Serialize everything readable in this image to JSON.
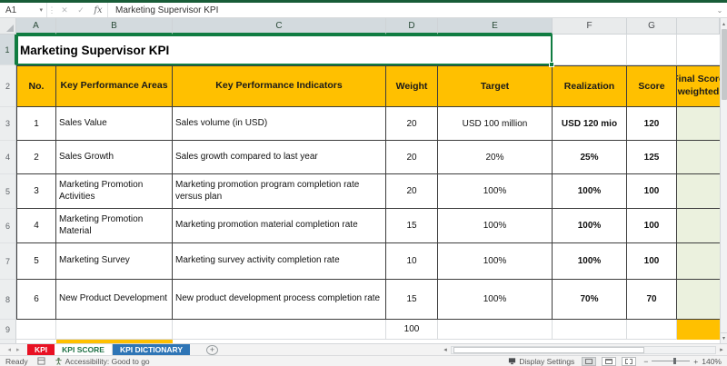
{
  "chrome": {
    "formula_bar": {
      "name_box": "A1",
      "formula": "Marketing Supervisor KPI",
      "fx_label": "fx"
    },
    "column_headers": [
      "A",
      "B",
      "C",
      "D",
      "E",
      "F",
      "G",
      ""
    ],
    "row_headers": [
      "1",
      "2",
      "3",
      "4",
      "5",
      "6",
      "7",
      "8",
      "9"
    ],
    "selected_cell": "A1"
  },
  "icons": {
    "dropdown": "▾",
    "dots": "⋮",
    "cancel": "✕",
    "enter": "✓",
    "expand": "⌄",
    "tab_left": "◂",
    "tab_right": "▸",
    "add_sheet": "+",
    "scroll_up": "▴",
    "scroll_down": "▾",
    "scroll_left": "◂",
    "scroll_right": "▸",
    "zoom_out": "−",
    "zoom_in": "+"
  },
  "sheet": {
    "title": "Marketing Supervisor KPI",
    "table": {
      "headers": {
        "no": "No.",
        "areas": "Key Performance Areas",
        "indicators": "Key Performance Indicators",
        "weight": "Weight",
        "target": "Target",
        "realization": "Realization",
        "score": "Score",
        "final": "Final Score weighted"
      },
      "rows": [
        {
          "no": "1",
          "area": "Sales Value",
          "indicator": "Sales volume (in USD)",
          "weight": "20",
          "target": "USD 100 million",
          "realization": "USD 120 mio",
          "score": "120"
        },
        {
          "no": "2",
          "area": "Sales Growth",
          "indicator": "Sales growth compared to last year",
          "weight": "20",
          "target": "20%",
          "realization": "25%",
          "score": "125"
        },
        {
          "no": "3",
          "area": "Marketing Promotion Activities",
          "indicator": "Marketing promotion program completion rate versus plan",
          "weight": "20",
          "target": "100%",
          "realization": "100%",
          "score": "100"
        },
        {
          "no": "4",
          "area": "Marketing Promotion Material",
          "indicator": "Marketing promotion material completion rate",
          "weight": "15",
          "target": "100%",
          "realization": "100%",
          "score": "100"
        },
        {
          "no": "5",
          "area": "Marketing Survey",
          "indicator": "Marketing survey activity completion rate",
          "weight": "10",
          "target": "100%",
          "realization": "100%",
          "score": "100"
        },
        {
          "no": "6",
          "area": "New Product Development",
          "indicator": "New product development process completion rate",
          "weight": "15",
          "target": "100%",
          "realization": "70%",
          "score": "70"
        }
      ],
      "total_weight": "100"
    }
  },
  "sheet_tabs": {
    "items": [
      {
        "label": "KPI",
        "color": "#E81123"
      },
      {
        "label": "KPI SCORE",
        "active": true
      },
      {
        "label": "KPI DICTIONARY",
        "color": "#2E75B6"
      }
    ]
  },
  "status_bar": {
    "ready": "Ready",
    "accessibility": "Accessibility: Good to go",
    "display_settings": "Display Settings",
    "zoom_level": "140%"
  },
  "colors": {
    "header_fill": "#FFC000",
    "final_column_fill": "#EBF1DE",
    "selection_green": "#107C41",
    "top_strip_green": "#185C37",
    "tab_red": "#E81123",
    "tab_blue": "#2E75B6",
    "active_tab_text": "#1E7145"
  }
}
